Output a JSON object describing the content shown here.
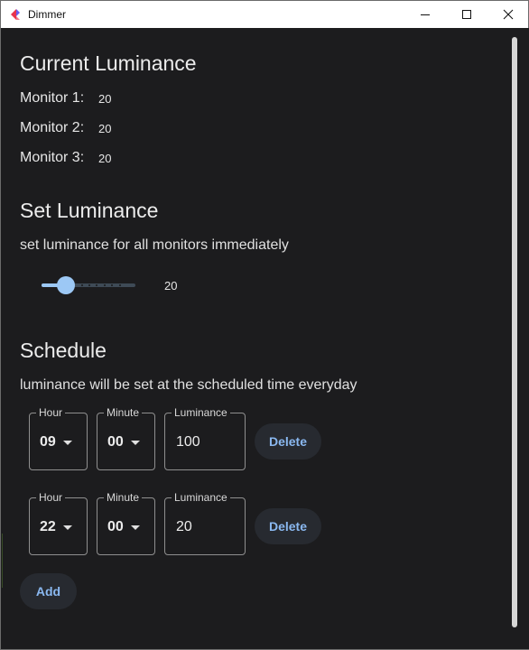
{
  "window": {
    "title": "Dimmer",
    "accent_colors": [
      "#e8344e",
      "#6a5cf0"
    ]
  },
  "current": {
    "heading": "Current Luminance",
    "monitors": [
      {
        "label": "Monitor 1:",
        "value": "20"
      },
      {
        "label": "Monitor 2:",
        "value": "20"
      },
      {
        "label": "Monitor 3:",
        "value": "20"
      }
    ]
  },
  "set": {
    "heading": "Set Luminance",
    "description": "set luminance for all monitors immediately",
    "slider": {
      "value": 20,
      "min": 0,
      "max": 100,
      "display": "20"
    }
  },
  "schedule": {
    "heading": "Schedule",
    "description": "luminance will be set at the scheduled time everyday",
    "labels": {
      "hour": "Hour",
      "minute": "Minute",
      "luminance": "Luminance",
      "delete": "Delete"
    },
    "rows": [
      {
        "hour": "09",
        "minute": "00",
        "luminance": "100"
      },
      {
        "hour": "22",
        "minute": "00",
        "luminance": "20"
      }
    ],
    "add_label": "Add"
  },
  "colors": {
    "background": "#1c1c1e",
    "accent": "#9cc8f5",
    "button_text": "#8ab8f0"
  }
}
